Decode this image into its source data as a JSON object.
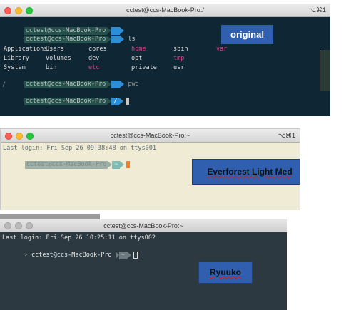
{
  "window1": {
    "title": "cctest@ccs-MacBook-Pro:/",
    "shortcut": "⌥⌘1",
    "prompt_user": "cctest@ccs-MacBook-Pro",
    "prompt_dir_root": "/",
    "cmd_ls": "ls",
    "cmd_pwd": "pwd",
    "pwd_output": "/",
    "ls_row1": [
      "Applications",
      "Users",
      "cores",
      "home",
      "sbin",
      "var"
    ],
    "ls_row2": [
      "Library",
      "Volumes",
      "dev",
      "opt",
      "tmp"
    ],
    "ls_row3": [
      "System",
      "bin",
      "etc",
      "private",
      "usr"
    ],
    "label": "original"
  },
  "window2": {
    "title": "cctest@ccs-MacBook-Pro:~",
    "shortcut": "⌥⌘1",
    "last_login": "Last login: Fri Sep 26 09:38:48 on ttys001",
    "prompt_user": "cctest@ccs-MacBook-Pro",
    "prompt_dir": "~",
    "label": "Everforest Light Med"
  },
  "window3": {
    "title": "cctest@ccs-MacBook-Pro:~",
    "last_login": "Last login: Fri Sep 26 10:25:11 on ttys002",
    "prompt_user": "cctest@ccs-MacBook-Pro",
    "prompt_dir": "~",
    "label": "Ryuuko"
  },
  "colors": {
    "original_bg": "#0f2634",
    "everforest_bg": "#efebd4",
    "ryuuko_bg": "#2c3940",
    "label_blue": "#2f5fae"
  }
}
